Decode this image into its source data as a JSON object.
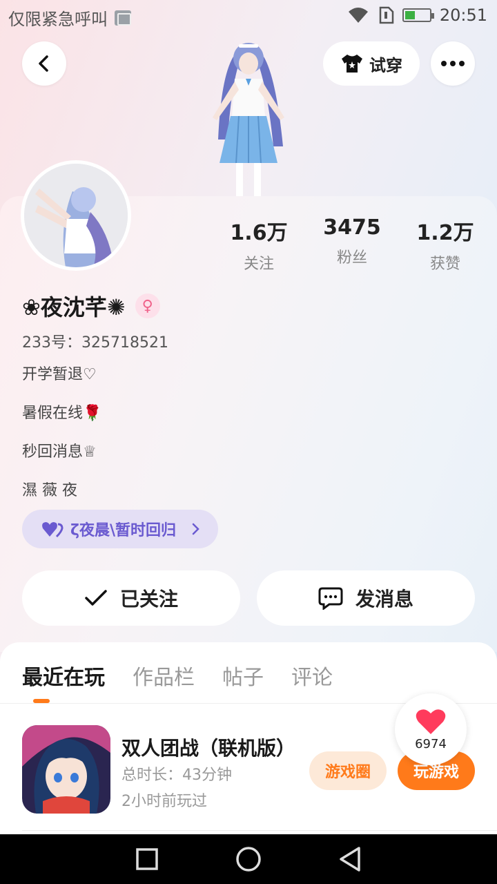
{
  "status_bar": {
    "left_text": "仅限紧急呼叫",
    "time": "20:51"
  },
  "header": {
    "tryon_label": "试穿"
  },
  "profile": {
    "stats": [
      {
        "value": "1.6万",
        "label": "关注"
      },
      {
        "value": "3475",
        "label": "粉丝"
      },
      {
        "value": "1.2万",
        "label": "获赞"
      }
    ],
    "nickname": "❀夜沈芊✺",
    "gender_symbol": "♀",
    "uid": "233号：325718521",
    "bio_lines": [
      "开学暂退♡",
      "暑假在线🌹",
      "秒回消息♕",
      "濕 薇 夜"
    ],
    "group_pill": "ζ夜晨\\暂时回归",
    "follow_label": "已关注",
    "message_label": "发消息"
  },
  "tabs": [
    "最近在玩",
    "作品栏",
    "帖子",
    "评论"
  ],
  "game": {
    "title": "双人团战（联机版）",
    "duration": "总时长：43分钟",
    "last_played": "2小时前玩过",
    "circle_label": "游戏圈",
    "play_label": "玩游戏"
  },
  "like_count": "6974",
  "colors": {
    "accent": "#ff7a1a",
    "purple": "#6a5ad0",
    "heart": "#ff3b5c"
  }
}
